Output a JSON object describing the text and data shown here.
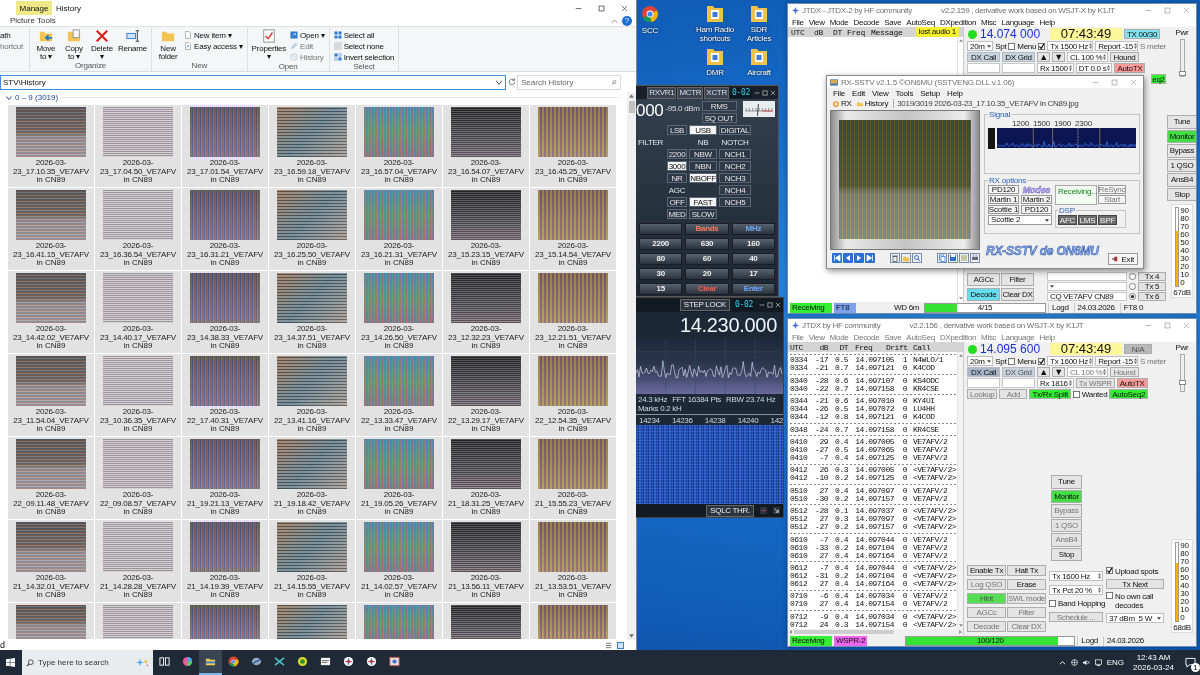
{
  "desktop_icons": [
    {
      "label": "SCC",
      "kind": "browser"
    },
    {
      "label": "Ham Radio shortcuts",
      "kind": "folder"
    },
    {
      "label": "SDR Articles",
      "kind": "folder"
    },
    {
      "label": "DMR",
      "kind": "folder"
    },
    {
      "label": "Aircraft",
      "kind": "folder"
    }
  ],
  "explorer": {
    "manage_tab": "Manage",
    "title": "History",
    "ribbon_tab": "Picture Tools",
    "help": "?",
    "ribbon": [
      {
        "commands": [
          {
            "label": "ath",
            "kind": "small",
            "disabled": false
          },
          {
            "label": "hortcut",
            "kind": "small",
            "disabled": true
          }
        ]
      },
      {
        "name": "Organize",
        "commands": [
          {
            "label": "Move to ▾",
            "kind": "large",
            "disabled": false
          },
          {
            "label": "Copy to ▾",
            "kind": "large",
            "disabled": false
          },
          {
            "label": "Delete ▾",
            "kind": "large",
            "disabled": false
          },
          {
            "label": "Rename",
            "kind": "large",
            "disabled": false
          }
        ]
      },
      {
        "name": "New",
        "commands": [
          {
            "label": "New folder",
            "kind": "large",
            "disabled": false
          },
          {
            "label": "New item ▾",
            "kind": "small",
            "disabled": false
          },
          {
            "label": "Easy access ▾",
            "kind": "small",
            "disabled": false
          }
        ]
      },
      {
        "name": "Open",
        "commands": [
          {
            "label": "Properties ▾",
            "kind": "large",
            "disabled": false
          },
          {
            "label": "Open ▾",
            "kind": "small",
            "disabled": false
          },
          {
            "label": "Edit",
            "kind": "small",
            "disabled": true
          },
          {
            "label": "History",
            "kind": "small",
            "disabled": true
          }
        ]
      },
      {
        "name": "Select",
        "commands": [
          {
            "label": "Select all",
            "kind": "small",
            "disabled": false
          },
          {
            "label": "Select none",
            "kind": "small",
            "disabled": false
          },
          {
            "label": "Invert selection",
            "kind": "small",
            "disabled": false
          }
        ]
      }
    ],
    "address": "STV\\History",
    "search": {
      "placeholder": "Search History"
    },
    "group": "0 – 9 (3019)",
    "files": [
      {
        "kind": "full",
        "name": "2026-03-23_17.10.35_VE7AFV",
        "place": "in CN89"
      },
      {
        "kind": "full",
        "name": "2026-03-23_17.04.50_VE7AFV",
        "place": "in CN89"
      },
      {
        "kind": "full",
        "name": "2026-03-23_17.01.54_VE7AFV",
        "place": "in CN89"
      },
      {
        "kind": "full",
        "name": "2026-03-23_16.59.18_VE7AFV",
        "place": "in CN89"
      },
      {
        "kind": "full",
        "name": "2026-03-23_16.57.04_VE7AFV",
        "place": "in CN89"
      },
      {
        "kind": "full",
        "name": "2026-03-23_16.54.07_VE7AFV",
        "place": "in CN89"
      },
      {
        "kind": "full",
        "name": "2026-03-23_16.45.25_VE7AFV",
        "place": "in CN89"
      },
      {
        "kind": "full",
        "name": "2026-03-23_16.41.15_VE7AFV",
        "place": "in CN89"
      },
      {
        "kind": "full",
        "name": "2026-03-23_16.36.54_VE7AFV",
        "place": "in CN89"
      },
      {
        "kind": "full",
        "name": "2026-03-23_16.31.21_VE7AFV",
        "place": "in CN89"
      },
      {
        "kind": "full",
        "name": "2026-03-23_16.25.50_VE7AFV",
        "place": "in CN89"
      },
      {
        "kind": "full",
        "name": "2026-03-23_16.21.31_VE7AFV",
        "place": "in CN89"
      },
      {
        "kind": "full",
        "name": "2026-03-23_15.23.15_VE7AFV",
        "place": "in CN89"
      },
      {
        "kind": "full",
        "name": "2026-03-23_15.14.54_VE7AFV",
        "place": "in CN89"
      },
      {
        "kind": "full",
        "name": "2026-03-23_14.42.02_VE7AFV",
        "place": "in CN89"
      },
      {
        "kind": "full",
        "name": "2026-03-23_14.40.17_VE7AFV",
        "place": "in CN89"
      },
      {
        "kind": "full",
        "name": "2026-03-23_14.38.33_VE7AFV",
        "place": "in CN89"
      },
      {
        "kind": "full",
        "name": "2026-03-23_14.37.51_VE7AFV",
        "place": "in CN89"
      },
      {
        "kind": "full",
        "name": "2026-03-23_14.26.50_VE7AFV",
        "place": "in CN89"
      },
      {
        "kind": "full",
        "name": "2026-03-23_12.32.23_VE7AFV",
        "place": "in CN89"
      },
      {
        "kind": "full",
        "name": "2026-03-23_12.21.51_VE7AFV",
        "place": "in CN89"
      },
      {
        "kind": "full",
        "name": "2026-03-23_11.54.04_VE7AFV",
        "place": "in CN89"
      },
      {
        "kind": "full",
        "name": "2026-03-23_10.36.35_VE7AFV",
        "place": "in CN89"
      },
      {
        "kind": "full",
        "name": "2026-03-22_17.40.31_VE7AFV",
        "place": "in CN89"
      },
      {
        "kind": "full",
        "name": "2026-03-22_13.41.16_VE7AFV",
        "place": "in CN89"
      },
      {
        "kind": "full",
        "name": "2026-03-22_13.33.47_VE7AFV",
        "place": "in CN89"
      },
      {
        "kind": "full",
        "name": "2026-03-22_13.29.17_VE7AFV",
        "place": "in CN89"
      },
      {
        "kind": "full",
        "name": "2026-03-22_12.54.35_VE7AFV",
        "place": "in CN89"
      },
      {
        "kind": "full",
        "name": "2026-03-22_09.11.48_VE7AFV",
        "place": "in CN89"
      },
      {
        "kind": "full",
        "name": "2026-03-22_09.08.57_VE7AFV",
        "place": "in CN89"
      },
      {
        "kind": "full",
        "name": "2026-03-21_19.21.13_VE7AFV",
        "place": "in CN89"
      },
      {
        "kind": "full",
        "name": "2026-03-21_19.18.42_VE7AFV",
        "place": "in CN89"
      },
      {
        "kind": "full",
        "name": "2026-03-21_19.05.26_VE7AFV",
        "place": "in CN89"
      },
      {
        "kind": "full",
        "name": "2026-03-21_18.31.25_VE7AFV",
        "place": "in CN89"
      },
      {
        "kind": "full",
        "name": "2026-03-21_15.55.23_VE7AFV",
        "place": "in CN89"
      },
      {
        "kind": "full",
        "name": "2026-03-21_14.32.01_VE7AFV",
        "place": "in CN89"
      },
      {
        "kind": "full",
        "name": "2026-03-21_14.28.28_VE7AFV",
        "place": "in CN89"
      },
      {
        "kind": "full",
        "name": "2026-03-21_14.19.39_VE7AFV",
        "place": "in CN89"
      },
      {
        "kind": "full",
        "name": "2026-03-21_14.15.55_VE7AFV",
        "place": "in CN89"
      },
      {
        "kind": "full",
        "name": "2026-03-21_14.02.57_VE7AFV",
        "place": "in CN89"
      },
      {
        "kind": "full",
        "name": "2026-03-21_13.56.11_VE7AFV",
        "place": "in CN89"
      },
      {
        "kind": "full",
        "name": "2026-03-21_13.53.51_VE7AFV",
        "place": "in CN89"
      },
      {
        "kind": "partial"
      },
      {
        "kind": "partial"
      },
      {
        "kind": "partial"
      },
      {
        "kind": "partial"
      },
      {
        "kind": "partial"
      },
      {
        "kind": "partial"
      },
      {
        "kind": "partial"
      }
    ],
    "status": "d"
  },
  "radio_panel": {
    "top_buttons": [
      "RXVR1",
      "MCTR",
      "XCTR"
    ],
    "display": "0-02",
    "frequency": "000",
    "level_text": "-95.0 dBm",
    "side_buttons": [
      "RMS",
      "SQ OUT"
    ],
    "buttons": [
      {
        "kind": "gap"
      },
      {
        "kind": "button",
        "label": "LSB",
        "selected": false
      },
      {
        "kind": "button",
        "label": "USB",
        "selected": true
      },
      {
        "kind": "button",
        "label": "DIGITAL",
        "selected": false
      },
      {
        "kind": "label",
        "label": "FILTER"
      },
      {
        "kind": "gap"
      },
      {
        "kind": "label",
        "label": "NB"
      },
      {
        "kind": "label",
        "label": "NOTCH"
      },
      {
        "kind": "gap"
      },
      {
        "kind": "button",
        "label": "2200",
        "selected": false
      },
      {
        "kind": "button",
        "label": "NBW",
        "selected": false
      },
      {
        "kind": "button",
        "label": "NCH1",
        "selected": false
      },
      {
        "kind": "gap"
      },
      {
        "kind": "button",
        "label": "3000",
        "selected": true
      },
      {
        "kind": "button",
        "label": "NBN",
        "selected": false
      },
      {
        "kind": "button",
        "label": "NCH2",
        "selected": false
      },
      {
        "kind": "gap"
      },
      {
        "kind": "button",
        "label": "NR",
        "selected": false
      },
      {
        "kind": "button",
        "label": "NBOFF",
        "selected": true
      },
      {
        "kind": "button",
        "label": "NCH3",
        "selected": false
      },
      {
        "kind": "gap"
      },
      {
        "kind": "label",
        "label": "AGC"
      },
      {
        "kind": "gap"
      },
      {
        "kind": "button",
        "label": "NCH4",
        "selected": false
      },
      {
        "kind": "gap"
      },
      {
        "kind": "button",
        "label": "OFF",
        "selected": false
      },
      {
        "kind": "button",
        "label": "FAST",
        "selected": true
      },
      {
        "kind": "button",
        "label": "NCH5",
        "selected": false
      },
      {
        "kind": "gap"
      },
      {
        "kind": "button",
        "label": "MED",
        "selected": false
      },
      {
        "kind": "button",
        "label": "SLOW",
        "selected": false
      }
    ],
    "band_buttons": [
      {
        "kind": "blank"
      },
      {
        "kind": "button",
        "label": "Bands",
        "color": "#ff7a5c"
      },
      {
        "kind": "button",
        "label": "MHz",
        "color": "#6aa8ff"
      },
      {
        "kind": "button",
        "label": "2200"
      },
      {
        "kind": "button",
        "label": "630"
      },
      {
        "kind": "button",
        "label": "160"
      },
      {
        "kind": "button",
        "label": "80"
      },
      {
        "kind": "button",
        "label": "60"
      },
      {
        "kind": "button",
        "label": "40"
      },
      {
        "kind": "button",
        "label": "30"
      },
      {
        "kind": "button",
        "label": "20"
      },
      {
        "kind": "button",
        "label": "17"
      },
      {
        "kind": "button",
        "label": "15"
      },
      {
        "kind": "button",
        "label": "Clear",
        "color": "#ff5a4a"
      },
      {
        "kind": "button",
        "label": "Enter",
        "color": "#6aa8ff"
      }
    ]
  },
  "sdr_window": {
    "step_lock": "STEP LOCK",
    "display": "0-02",
    "frequency": "14.230.000",
    "info": [
      "24.3 kHz",
      "FFT 16384 Pts",
      "RBW 23.74 Hz",
      "Marks 0.2 kH"
    ],
    "scale": [
      "14234",
      "14236",
      "14238",
      "14240",
      "142"
    ],
    "squelch": "SQLC THR."
  },
  "jtdx_ft8": {
    "title": "JTDX - JTDX-2  by HF community",
    "version": "v2.2.159 , derivative work based on WSJT-X by K1JT",
    "menu_disabled": false,
    "menu": [
      "File",
      "View",
      "Mode",
      "Decode",
      "Save",
      "AutoSeq",
      "DXpedition",
      "Misc",
      "Language",
      "Help"
    ],
    "columns": [
      "UTC",
      "dB",
      "DT",
      "Freq",
      "Message"
    ],
    "badge": "lost audio 1",
    "lines": [
      {
        "controls": [
          {
            "kind": "dot",
            "color": "#22dd22"
          },
          {
            "kind": "freq",
            "label": "14.074 000"
          },
          {
            "kind": "clock",
            "label": "07:43:49"
          },
          {
            "kind": "button",
            "label": "TX 00/30",
            "color": "#80e4f0",
            "disabled": false
          }
        ]
      },
      {
        "controls": [
          {
            "kind": "dropdown",
            "label": "20m",
            "disabled": false
          },
          {
            "kind": "labelcheck",
            "label": "Spt",
            "checked": false,
            "disabled": false
          },
          {
            "kind": "labelcheck",
            "label": "Menu",
            "checked": true,
            "disabled": false
          },
          {
            "kind": "spin",
            "label": "Tx 1500 Hz",
            "disabled": false
          },
          {
            "kind": "spin",
            "label": "Report -15",
            "disabled": false
          },
          {
            "kind": "label",
            "label": "S meter",
            "disabled": true
          }
        ]
      },
      {
        "controls": [
          {
            "kind": "head",
            "label": "DX Call",
            "disabled": false
          },
          {
            "kind": "head",
            "label": "DX Grid",
            "disabled": false
          },
          {
            "kind": "arrow",
            "label": "▲",
            "disabled": false
          },
          {
            "kind": "arrow",
            "label": "▼",
            "disabled": false
          },
          {
            "kind": "spin",
            "label": "CL 100 %",
            "disabled": false
          },
          {
            "kind": "button",
            "label": "Hound",
            "disabled": false
          }
        ]
      },
      {
        "controls": [
          {
            "kind": "field"
          },
          {
            "kind": "field"
          },
          {
            "kind": "spin",
            "label": "Rx 1500",
            "disabled": false
          },
          {
            "kind": "spin",
            "label": "DT 0.0 s",
            "disabled": false
          },
          {
            "kind": "button",
            "label": "AutoTX",
            "color": "#ff9c9c",
            "disabled": false
          }
        ]
      }
    ],
    "partial_button": {
      "label": "eq2",
      "color": "#33ee33"
    },
    "power": {
      "label": "Pwr",
      "level": 0
    },
    "side_buttons": [
      {
        "label": "Tune",
        "disabled": false
      },
      {
        "label": "Monitor",
        "color": "#44dd44",
        "disabled": false
      },
      {
        "label": "Bypass",
        "disabled": false
      },
      {
        "label": "1 QSO",
        "disabled": false
      },
      {
        "label": "AnsB4",
        "disabled": false
      },
      {
        "label": "Stop",
        "disabled": false
      }
    ],
    "decode_buttons": [
      {
        "label": "AGCc",
        "disabled": false
      },
      {
        "label": "Filter",
        "disabled": false
      },
      {
        "label": "Decode",
        "color": "#66ddee",
        "disabled": false
      },
      {
        "label": "Clear DX",
        "disabled": false
      }
    ],
    "messages": [
      {
        "button": "Tx 4",
        "dropdown": false,
        "selected": false
      },
      {
        "button": "Tx 5",
        "dropdown": true,
        "selected": false
      },
      {
        "value": "CQ VE7AFV CN89",
        "button": "Tx 6",
        "dropdown": false,
        "selected": true
      }
    ],
    "meter": {
      "level": 0.7,
      "ticks": [
        "90",
        "80",
        "70",
        "60",
        "50",
        "40",
        "30",
        "20",
        "10",
        "0"
      ],
      "reading": "67dB"
    },
    "status": {
      "state": {
        "text": "Receiving",
        "color": "#33ee33"
      },
      "mode": {
        "text": "FT8",
        "color": "#7fa2ee"
      },
      "band": "WD 6m",
      "progress": {
        "text": "4/15",
        "level": 0.27
      },
      "log": "Logd",
      "date": "24.03.2026",
      "extra": "FT8 0"
    }
  },
  "rx_sstv": {
    "title": "RX-SSTV v2.1.5 ©ON6MU (SSTVENG.DLL v.1.06)",
    "menu": [
      "File",
      "Edit",
      "View",
      "Tools",
      "Setup",
      "Help"
    ],
    "toolbar": {
      "rx": "RX",
      "history": "History",
      "path": "3019/3019 2026-03-23_17.10.35_VE7AFV in CN89.jpg"
    },
    "signal": {
      "title": "Signal",
      "ticks": [
        "1200",
        "1500",
        "1900",
        "2300"
      ]
    },
    "rx_options": {
      "title": "RX options",
      "modes": [
        "PD120",
        "Martin 1",
        "Martin 2",
        "Scottie 1",
        "PD120"
      ],
      "modes_logo": "Modes",
      "mode_select": "Scottie 2",
      "status": "Receiving...",
      "controls": [
        {
          "label": "ReSync",
          "disabled": true
        },
        {
          "label": "Start",
          "disabled": true
        }
      ],
      "dsp": {
        "title": "DSP",
        "buttons": [
          "AFC",
          "LMS",
          "BPF"
        ]
      }
    },
    "logo": "RX-SSTV de ON6MU",
    "exit": "Exit"
  },
  "jtdx_wspr": {
    "title": "JTDX  by HF community",
    "version": "v2.2.156 , derivative work based on WSJT-X by K1JT",
    "menu_disabled": true,
    "menu": [
      "File",
      "View",
      "Mode",
      "Decode",
      "Save",
      "AutoSeq",
      "DXpedition",
      "Misc",
      "Language",
      "Help"
    ],
    "columns": [
      "UTC",
      "dB",
      "DT",
      "Freq",
      "Drift",
      "Call"
    ],
    "decodes": [
      [
        {
          "utc": "0334",
          "db": "-17",
          "dt": "0.5",
          "freq": "14.097105",
          "drift": "1",
          "call": "N4WLO/1"
        },
        {
          "utc": "0334",
          "db": "-21",
          "dt": "0.7",
          "freq": "14.097121",
          "drift": "0",
          "call": "K4COD"
        }
      ],
      [
        {
          "utc": "0340",
          "db": "-28",
          "dt": "0.6",
          "freq": "14.097107",
          "drift": "0",
          "call": "KS4ODC"
        },
        {
          "utc": "0340",
          "db": "-22",
          "dt": "0.7",
          "freq": "14.097158",
          "drift": "0",
          "call": "KR4CSE"
        }
      ],
      [
        {
          "utc": "0344",
          "db": "-21",
          "dt": "0.6",
          "freq": "14.097010",
          "drift": "0",
          "call": "KY4UI"
        },
        {
          "utc": "0344",
          "db": "-26",
          "dt": "0.5",
          "freq": "14.097072",
          "drift": "0",
          "call": "LU4HH"
        },
        {
          "utc": "0344",
          "db": "-12",
          "dt": "0.8",
          "freq": "14.097121",
          "drift": "0",
          "call": "K4COD"
        }
      ],
      [
        {
          "utc": "0348",
          "db": "-24",
          "dt": "0.7",
          "freq": "14.097158",
          "drift": "0",
          "call": "KR4CSE"
        }
      ],
      [
        {
          "utc": "0410",
          "db": "29",
          "dt": "0.4",
          "freq": "14.097005",
          "drift": "0",
          "call": "VE7AFV/2"
        },
        {
          "utc": "0410",
          "db": "-27",
          "dt": "0.5",
          "freq": "14.097065",
          "drift": "0",
          "call": "VE7AFV/2"
        },
        {
          "utc": "0410",
          "db": "-7",
          "dt": "0.4",
          "freq": "14.097125",
          "drift": "0",
          "call": "VE7AFV/2"
        }
      ],
      [
        {
          "utc": "0412",
          "db": "26",
          "dt": "0.3",
          "freq": "14.097005",
          "drift": "0",
          "call": "<VE7AFV/2>"
        },
        {
          "utc": "0412",
          "db": "-10",
          "dt": "0.2",
          "freq": "14.097125",
          "drift": "0",
          "call": "<VE7AFV/2>"
        }
      ],
      [
        {
          "utc": "0510",
          "db": "27",
          "dt": "0.4",
          "freq": "14.097097",
          "drift": "0",
          "call": "VE7AFV/2"
        },
        {
          "utc": "0510",
          "db": "-30",
          "dt": "0.2",
          "freq": "14.097157",
          "drift": "0",
          "call": "VE7AFV/2"
        }
      ],
      [
        {
          "utc": "0512",
          "db": "-28",
          "dt": "0.1",
          "freq": "14.097037",
          "drift": "0",
          "call": "<VE7AFV/2>"
        },
        {
          "utc": "0512",
          "db": "27",
          "dt": "0.3",
          "freq": "14.097097",
          "drift": "0",
          "call": "<VE7AFV/2>"
        },
        {
          "utc": "0512",
          "db": "-27",
          "dt": "0.2",
          "freq": "14.097157",
          "drift": "0",
          "call": "<VE7AFV/2>"
        }
      ],
      [
        {
          "utc": "0610",
          "db": "-7",
          "dt": "0.4",
          "freq": "14.097044",
          "drift": "0",
          "call": "VE7AFV/2"
        },
        {
          "utc": "0610",
          "db": "-33",
          "dt": "0.2",
          "freq": "14.097104",
          "drift": "0",
          "call": "VE7AFV/2"
        },
        {
          "utc": "0610",
          "db": "27",
          "dt": "0.4",
          "freq": "14.097164",
          "drift": "0",
          "call": "VE7AFV/2"
        }
      ],
      [
        {
          "utc": "0612",
          "db": "-7",
          "dt": "0.4",
          "freq": "14.097044",
          "drift": "0",
          "call": "<VE7AFV/2>"
        },
        {
          "utc": "0612",
          "db": "-31",
          "dt": "0.2",
          "freq": "14.097104",
          "drift": "0",
          "call": "<VE7AFV/2>"
        },
        {
          "utc": "0612",
          "db": "27",
          "dt": "0.4",
          "freq": "14.097164",
          "drift": "0",
          "call": "<VE7AFV/2>"
        }
      ],
      [
        {
          "utc": "0710",
          "db": "-6",
          "dt": "0.4",
          "freq": "14.097034",
          "drift": "0",
          "call": "VE7AFV/2"
        },
        {
          "utc": "0710",
          "db": "27",
          "dt": "0.4",
          "freq": "14.097154",
          "drift": "0",
          "call": "VE7AFV/2"
        }
      ],
      [
        {
          "utc": "0712",
          "db": "-9",
          "dt": "0.4",
          "freq": "14.097034",
          "drift": "0",
          "call": "<VE7AFV/2>"
        },
        {
          "utc": "0712",
          "db": "24",
          "dt": "0.3",
          "freq": "14.097154",
          "drift": "0",
          "call": "<VE7AFV/2>"
        }
      ]
    ],
    "lines": [
      {
        "controls": [
          {
            "kind": "dot",
            "color": "#22dd22"
          },
          {
            "kind": "freq",
            "label": "14.095 600"
          },
          {
            "kind": "clock",
            "label": "07:43:49"
          },
          {
            "kind": "button",
            "label": "N/A",
            "color": "#b8b8b8",
            "disabled": true
          }
        ]
      },
      {
        "controls": [
          {
            "kind": "dropdown",
            "label": "20m",
            "disabled": false
          },
          {
            "kind": "labelcheck",
            "label": "Spt",
            "checked": false,
            "disabled": false
          },
          {
            "kind": "labelcheck",
            "label": "Menu",
            "checked": true,
            "disabled": false
          },
          {
            "kind": "spin",
            "label": "Tx 1600 Hz",
            "disabled": false
          },
          {
            "kind": "spin",
            "label": "Report -15",
            "disabled": false
          },
          {
            "kind": "label",
            "label": "S meter",
            "disabled": true
          }
        ]
      },
      {
        "controls": [
          {
            "kind": "head",
            "label": "DX Call",
            "color": "#a7b6c8",
            "disabled": false
          },
          {
            "kind": "head",
            "label": "DX Grid",
            "disabled": true
          },
          {
            "kind": "arrow",
            "label": "▲",
            "disabled": false
          },
          {
            "kind": "arrow",
            "label": "▼",
            "disabled": false
          },
          {
            "kind": "spin",
            "label": "CL 100 %",
            "disabled": true
          },
          {
            "kind": "button",
            "label": "Hound",
            "disabled": true
          }
        ]
      },
      {
        "controls": [
          {
            "kind": "field"
          },
          {
            "kind": "field"
          },
          {
            "kind": "spin",
            "label": "Rx 1816",
            "disabled": false
          },
          {
            "kind": "button",
            "label": "Tx WSPR",
            "disabled": true
          },
          {
            "kind": "button",
            "label": "AutoTX",
            "color": "#ff9c9c",
            "disabled": false
          }
        ]
      },
      {
        "controls": [
          {
            "kind": "button",
            "label": "Lookup",
            "disabled": true
          },
          {
            "kind": "button",
            "label": "Add",
            "disabled": true
          },
          {
            "kind": "button",
            "label": "Tx/Rx Split",
            "color": "#33ee33",
            "disabled": false
          },
          {
            "kind": "check",
            "label": "Wanted",
            "checked": false,
            "disabled": false
          },
          {
            "kind": "button",
            "label": "AutoSeq2",
            "color": "#33ee33",
            "disabled": false
          }
        ]
      }
    ],
    "power": {
      "label": "Pwr",
      "level": 0.2
    },
    "center_buttons": [
      {
        "label": "Tune",
        "disabled": false
      },
      {
        "label": "Monitor",
        "color": "#44dd44",
        "disabled": false
      },
      {
        "label": "Bypass",
        "disabled": true
      },
      {
        "label": "1 QSO",
        "disabled": true
      },
      {
        "label": "AnsB4",
        "disabled": true
      },
      {
        "label": "Stop",
        "disabled": false
      }
    ],
    "bottom_buttons": [
      {
        "label": "Enable Tx",
        "disabled": false
      },
      {
        "label": "Halt Tx",
        "disabled": false
      },
      {
        "label": "Log QSO",
        "disabled": true
      },
      {
        "label": "Erase",
        "disabled": false
      },
      {
        "label": "Hint",
        "color": "#55dd55",
        "disabled": true
      },
      {
        "label": "SWL mode",
        "disabled": true
      },
      {
        "label": "AGCc",
        "disabled": true
      },
      {
        "label": "Filter",
        "disabled": true
      },
      {
        "label": "Decode",
        "disabled": true
      },
      {
        "label": "Clear DX",
        "disabled": true
      }
    ],
    "middle_controls": [
      {
        "kind": "spin",
        "label": "Tx 1600 Hz",
        "disabled": false
      },
      {
        "kind": "spin",
        "label": "Tx Pct 20 %",
        "disabled": false
      },
      {
        "kind": "check",
        "label": "Band Hopping",
        "checked": false,
        "disabled": false
      },
      {
        "kind": "button",
        "label": "Schedule ...",
        "disabled": true
      }
    ],
    "right_controls": [
      {
        "kind": "check",
        "label": "Upload spots",
        "checked": true,
        "disabled": false
      },
      {
        "kind": "button",
        "label": "Tx Next",
        "disabled": false
      },
      {
        "kind": "check",
        "label": "No own call decodes",
        "checked": false,
        "disabled": false
      },
      {
        "kind": "dropdown",
        "label": "37 dBm  5 W",
        "disabled": false
      }
    ],
    "meter": {
      "level": 0.75,
      "ticks": [
        "90",
        "80",
        "70",
        "60",
        "50",
        "40",
        "30",
        "20",
        "10",
        "0"
      ],
      "reading": "68dB"
    },
    "status": {
      "state": {
        "text": "Receiving",
        "color": "#33ee33"
      },
      "mode": {
        "text": "WSPR-2",
        "color": "#ee66ee"
      },
      "progress": {
        "text": "100/120",
        "level": 0.9
      },
      "log": "Logd",
      "date": "24.03.2026"
    }
  },
  "taskbar": {
    "search": {
      "placeholder": "Type here to search"
    },
    "apps": [
      {
        "selected": false
      },
      {
        "selected": false
      },
      {
        "selected": true
      },
      {
        "selected": false
      },
      {
        "selected": false
      },
      {
        "selected": false
      },
      {
        "selected": false
      },
      {
        "selected": false
      },
      {
        "selected": false
      },
      {
        "selected": false
      },
      {
        "selected": false
      }
    ],
    "tray": {
      "language": "ENG",
      "time": "12:43 AM",
      "date": "2026-03-24",
      "badge": "1"
    }
  }
}
